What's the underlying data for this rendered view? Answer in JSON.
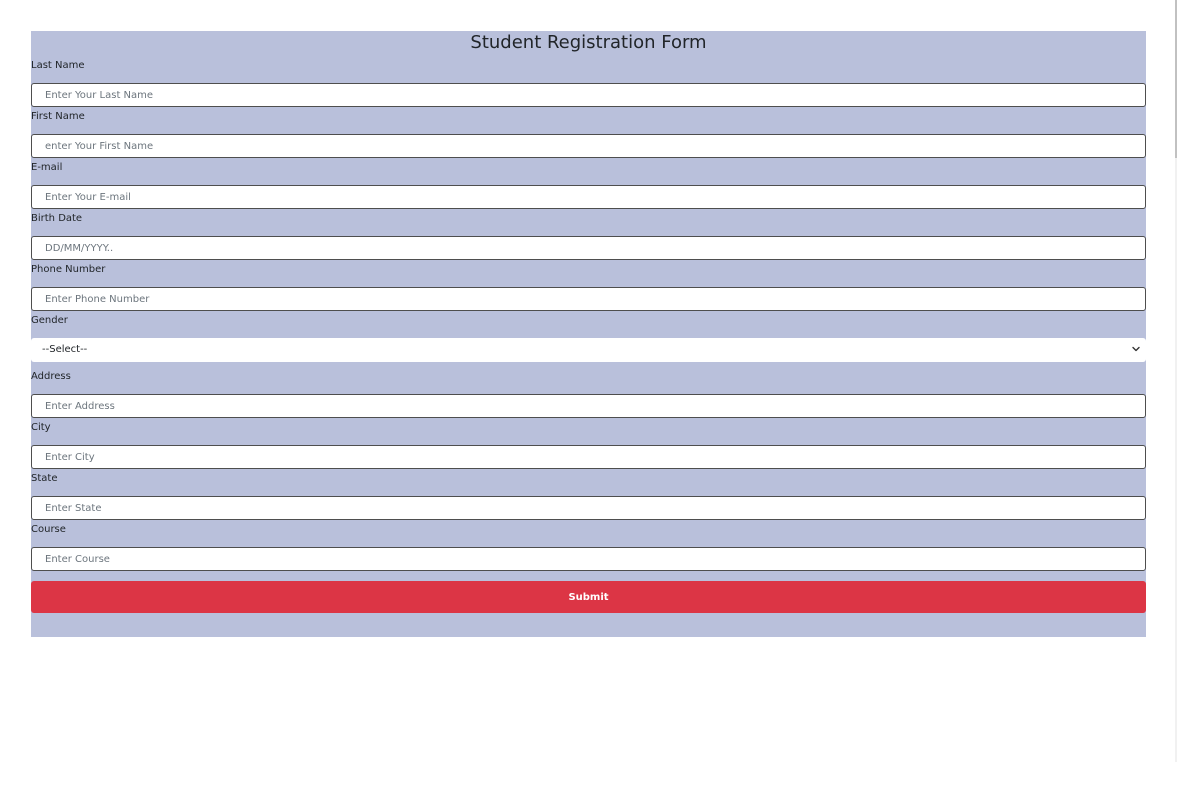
{
  "form": {
    "title": "Student Registration Form",
    "fields": {
      "last_name": {
        "label": "Last Name",
        "placeholder": "Enter Your Last Name"
      },
      "first_name": {
        "label": "First Name",
        "placeholder": "enter Your First Name"
      },
      "email": {
        "label": "E-mail",
        "placeholder": "Enter Your E-mail"
      },
      "birth_date": {
        "label": "Birth Date",
        "placeholder": "DD/MM/YYYY.."
      },
      "phone": {
        "label": "Phone Number",
        "placeholder": "Enter Phone Number"
      },
      "gender": {
        "label": "Gender",
        "selected": "--Select--"
      },
      "address": {
        "label": "Address",
        "placeholder": "Enter Address"
      },
      "city": {
        "label": "City",
        "placeholder": "Enter City"
      },
      "state": {
        "label": "State",
        "placeholder": "Enter State"
      },
      "course": {
        "label": "Course",
        "placeholder": "Enter Course"
      }
    },
    "submit_label": "Submit"
  },
  "icons": {
    "select_chevron": "chevron-down-icon"
  },
  "colors": {
    "form_background": "#b9c0db",
    "submit_background": "#dc3545",
    "submit_text": "#ffffff",
    "input_border": "#4e4e4e",
    "text": "#212529",
    "placeholder": "#6c757d"
  }
}
